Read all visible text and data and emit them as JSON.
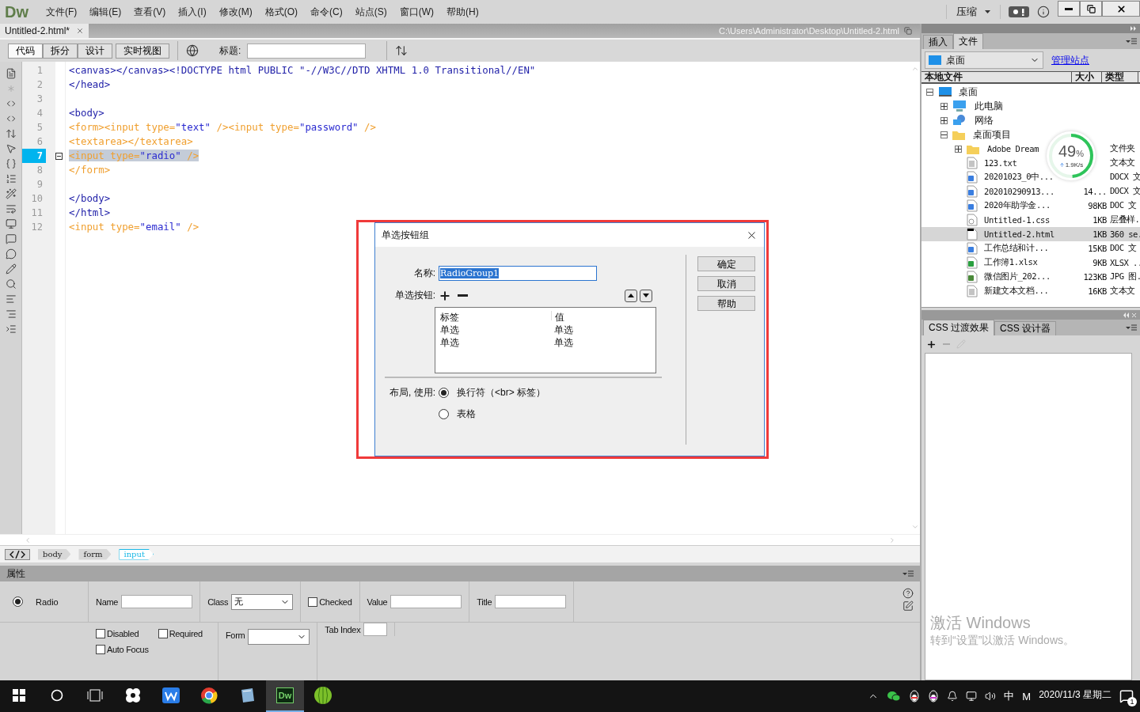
{
  "app": {
    "logo": "Dw",
    "menu": [
      "文件(F)",
      "编辑(E)",
      "查看(V)",
      "插入(I)",
      "修改(M)",
      "格式(O)",
      "命令(C)",
      "站点(S)",
      "窗口(W)",
      "帮助(H)"
    ],
    "compress": "压缩"
  },
  "document": {
    "tab": "Untitled-2.html*",
    "path": "C:\\Users\\Administrator\\Desktop\\Untitled-2.html"
  },
  "toolbar": {
    "views": [
      {
        "label": "代码",
        "selected": true
      },
      {
        "label": "拆分",
        "selected": false
      },
      {
        "label": "设计",
        "selected": false
      },
      {
        "label": "实时视图",
        "selected": false
      }
    ],
    "title_label": "标题:"
  },
  "code": [
    {
      "number": "1",
      "selected": false,
      "foldable": false,
      "segments": [
        {
          "text": "<canvas></canvas><!DOCTYPE html PUBLIC \"-//W3C//DTD XHTML 1.0 Transitional//EN\"",
          "kind": "tag"
        }
      ]
    },
    {
      "number": "2",
      "selected": false,
      "foldable": false,
      "segments": [
        {
          "text": "</head>",
          "kind": "tag"
        }
      ]
    },
    {
      "number": "3",
      "selected": false,
      "foldable": false
    },
    {
      "number": "4",
      "selected": false,
      "foldable": false,
      "segments": [
        {
          "text": "<body>",
          "kind": "tag"
        }
      ]
    },
    {
      "number": "5",
      "selected": false,
      "foldable": false,
      "segments": [
        {
          "text": "<form><input type=",
          "kind": "form"
        },
        {
          "text": "\"text\"",
          "kind": "value"
        },
        {
          "text": " /><input type=",
          "kind": "form"
        },
        {
          "text": "\"password\"",
          "kind": "value"
        },
        {
          "text": " />",
          "kind": "form"
        }
      ]
    },
    {
      "number": "6",
      "selected": false,
      "foldable": false,
      "segments": [
        {
          "text": "<textarea></textarea>",
          "kind": "form"
        }
      ]
    },
    {
      "number": "7",
      "selected": true,
      "foldable": true,
      "segments": [
        {
          "text": "<input type=",
          "kind": "form"
        },
        {
          "text": "\"radio\"",
          "kind": "value"
        },
        {
          "text": " />",
          "kind": "form"
        }
      ]
    },
    {
      "number": "8",
      "selected": false,
      "foldable": false,
      "segments": [
        {
          "text": "</form>",
          "kind": "form"
        }
      ]
    },
    {
      "number": "9",
      "selected": false,
      "foldable": false
    },
    {
      "number": "10",
      "selected": false,
      "foldable": false,
      "segments": [
        {
          "text": "</body>",
          "kind": "tag"
        }
      ]
    },
    {
      "number": "11",
      "selected": false,
      "foldable": false,
      "segments": [
        {
          "text": "</html>",
          "kind": "tag"
        }
      ]
    },
    {
      "number": "12",
      "selected": false,
      "foldable": false,
      "segments": [
        {
          "text": "<input type=",
          "kind": "form"
        },
        {
          "text": "\"email\"",
          "kind": "value"
        },
        {
          "text": " />",
          "kind": "form"
        }
      ]
    }
  ],
  "tag_selector": [
    {
      "label": "body",
      "selected": false
    },
    {
      "label": "form",
      "selected": false
    },
    {
      "label": "input",
      "selected": true
    }
  ],
  "properties": {
    "header": "属性",
    "element": "Radio",
    "row1": [
      {
        "kind": "input",
        "label": "Name"
      },
      {
        "kind": "select",
        "label": "Class",
        "value": "无"
      },
      {
        "kind": "checkbox",
        "label": "Checked",
        "checked": false
      },
      {
        "kind": "input",
        "label": "Value"
      },
      {
        "kind": "input",
        "label": "Title"
      }
    ],
    "row2": [
      {
        "kind": "checks",
        "items": [
          {
            "label": "Disabled",
            "checked": false
          },
          {
            "label": "Required",
            "checked": false
          },
          {
            "label": "Auto Focus",
            "checked": false
          }
        ]
      },
      {
        "kind": "select",
        "label": "Form"
      },
      {
        "kind": "input",
        "label": "Tab Index"
      }
    ]
  },
  "dialog": {
    "title": "单选按钮组",
    "name_label": "名称:",
    "name_value": "RadioGroup1",
    "name_selected": true,
    "buttons_label": "单选按钮:",
    "columns": [
      "标签",
      "值"
    ],
    "rows": [
      {
        "label": "单选",
        "value": "单选"
      },
      {
        "label": "单选",
        "value": "单选"
      }
    ],
    "layout_label": "布局, 使用:",
    "layout_options": [
      {
        "label": "换行符（<br> 标签）",
        "selected": true
      },
      {
        "label": "表格",
        "selected": false
      }
    ],
    "actions": [
      "确定",
      "取消",
      "帮助"
    ]
  },
  "files_panel": {
    "tabs": [
      {
        "label": "插入",
        "selected": false
      },
      {
        "label": "文件",
        "selected": true
      }
    ],
    "site": "桌面",
    "manage": "管理站点",
    "columns": [
      "本地文件",
      "大小",
      "类型"
    ],
    "tree": [
      {
        "name": "桌面",
        "kind": "desktop",
        "expanded": true,
        "selected": false,
        "children": [
          {
            "name": "此电脑",
            "kind": "computer",
            "expanded": false,
            "selected": false
          },
          {
            "name": "网络",
            "kind": "network",
            "expanded": false,
            "selected": false
          },
          {
            "name": "桌面项目",
            "kind": "folder",
            "expanded": true,
            "selected": false,
            "children": [
              {
                "name": "Adobe Dream",
                "kind": "folder",
                "expanded": false,
                "selected": false,
                "type": "文件夹"
              },
              {
                "name": "123.txt",
                "kind": "text",
                "selected": false,
                "type": "文本文"
              },
              {
                "name": "20201023_0中...",
                "kind": "word",
                "selected": false,
                "type": "DOCX 文"
              },
              {
                "name": "202010290913...",
                "kind": "word",
                "selected": false,
                "size": "14...",
                "type": "DOCX 文"
              },
              {
                "name": "2020年助学金...",
                "kind": "word",
                "selected": false,
                "size": "98KB",
                "type": "DOC 文"
              },
              {
                "name": "Untitled-1.css",
                "kind": "css",
                "selected": false,
                "size": "1KB",
                "type": "层叠样."
              },
              {
                "name": "Untitled-2.html",
                "kind": "html",
                "selected": true,
                "size": "1KB",
                "type": "360 se."
              },
              {
                "name": "工作总结和计...",
                "kind": "word",
                "selected": false,
                "size": "15KB",
                "type": "DOC 文"
              },
              {
                "name": "工作簿1.xlsx",
                "kind": "sheet",
                "selected": false,
                "size": "9KB",
                "type": "XLSX .."
              },
              {
                "name": "微信图片_202...",
                "kind": "image",
                "selected": false,
                "size": "123KB",
                "type": "JPG 图."
              },
              {
                "name": "新建文本文档...",
                "kind": "text",
                "selected": false,
                "size": "16KB",
                "type": "文本文"
              }
            ]
          }
        ]
      }
    ]
  },
  "css_panel": {
    "tabs": [
      {
        "label": "CSS 过渡效果",
        "selected": true
      },
      {
        "label": "CSS 设计器",
        "selected": false
      }
    ]
  },
  "activation": {
    "title": "激活 Windows",
    "hint": "转到“设置”以激活 Windows。"
  },
  "speed_widget": {
    "percent": "49",
    "unit": "%",
    "speed": "1.9K/s",
    "level": 0.49
  },
  "taskbar": {
    "apps": [
      {
        "kind": "windows",
        "active": false
      },
      {
        "kind": "search",
        "active": false
      },
      {
        "kind": "taskview",
        "active": false
      },
      {
        "kind": "pinwheel",
        "active": false
      },
      {
        "kind": "wps",
        "active": false
      },
      {
        "kind": "chrome",
        "active": false
      },
      {
        "kind": "notepad",
        "active": false
      },
      {
        "kind": "dw",
        "label": "Dw",
        "active": true
      },
      {
        "kind": "melon",
        "active": false
      }
    ],
    "ime": "中",
    "ime_mode": "M",
    "date": "2020/11/3 星期二",
    "notifications": "1"
  }
}
